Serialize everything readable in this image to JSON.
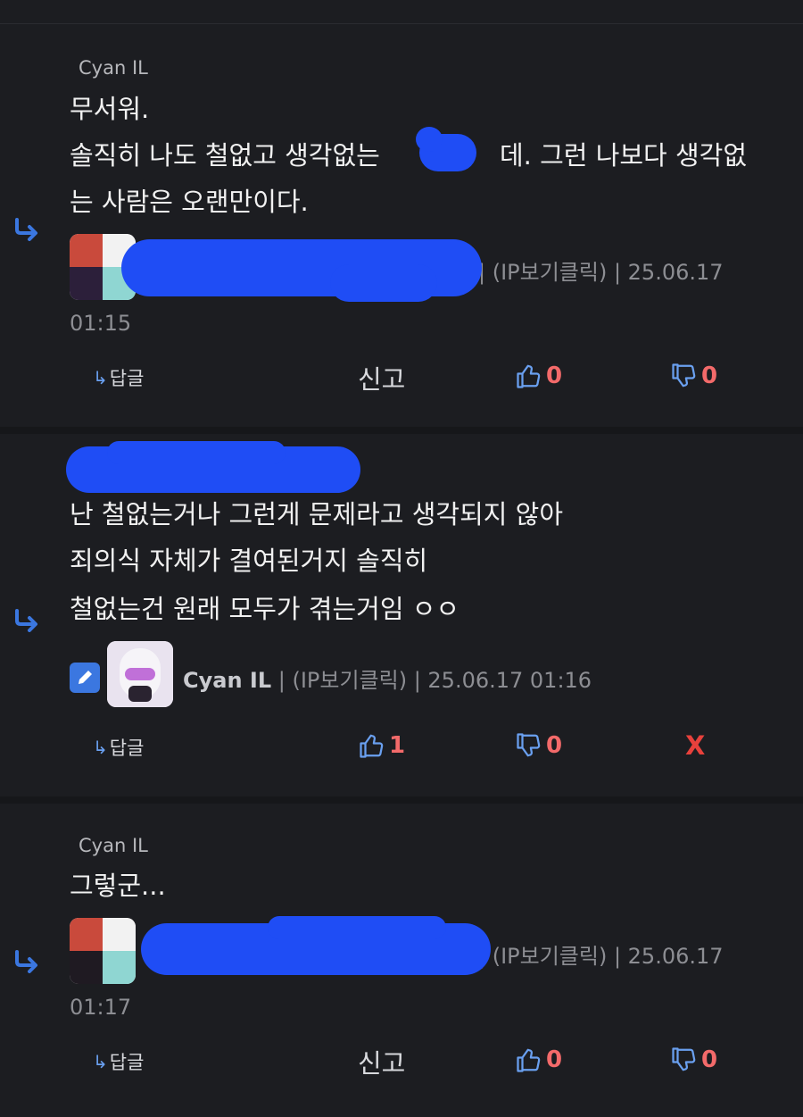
{
  "colors": {
    "background": "#1c1d21",
    "accent_blue": "#3b77e0",
    "vote_count": "#f36a6a",
    "delete": "#e8413c",
    "redaction": "#1f4df5"
  },
  "comments": [
    {
      "mention": "Cyan IL",
      "lines": [
        "무서워.",
        "솔직히 나도 철없고 생각없는 ",
        "데. 그런 나보다 생각없",
        "는 사람은 오랜만이다."
      ],
      "line1_partial_prefix": "솔직히 나도 철없고 생각없는 ",
      "line1_partial_suffix": "데. 그런 나보다 생각없",
      "meta_rest": "| (IP보기클릭) | 25.06.17",
      "time_line2": "01:15",
      "reply_label": "답글",
      "report_label": "신고",
      "likes": "0",
      "dislikes": "0"
    },
    {
      "lines": [
        "난 철없는거나 그런게 문제라고 생각되지 않아",
        "죄의식 자체가 결여된거지 솔직히",
        "철없는건 원래 모두가 겪는거임 ㅇㅇ"
      ],
      "author": "Cyan IL",
      "meta_rest": " | (IP보기클릭) | 25.06.17 01:16",
      "reply_label": "답글",
      "likes": "1",
      "dislikes": "0",
      "delete_label": "X"
    },
    {
      "mention": "Cyan IL",
      "lines": [
        "그렇군..."
      ],
      "meta_rest": "| (IP보기클릭) | 25.06.17",
      "time_line2": "01:17",
      "reply_label": "답글",
      "report_label": "신고",
      "likes": "0",
      "dislikes": "0"
    }
  ]
}
